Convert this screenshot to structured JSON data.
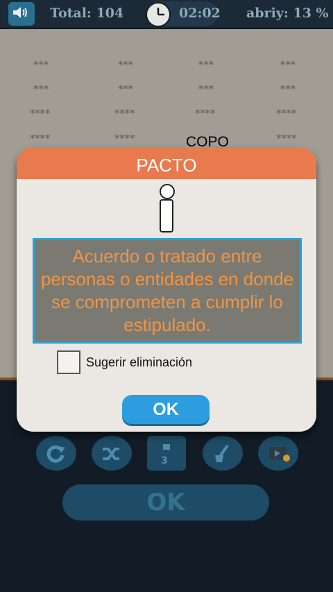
{
  "topbar": {
    "total_label": "Total: 104",
    "time": "02:02",
    "progress_label": "abriy: 13 %"
  },
  "board": {
    "rows": [
      [
        "***",
        "***",
        "***",
        "***"
      ],
      [
        "***",
        "***",
        "***",
        "***"
      ],
      [
        "****",
        "****",
        "****",
        "****"
      ],
      [
        "****",
        "****",
        "",
        "****"
      ]
    ],
    "overlay_word": "COPO"
  },
  "dialog": {
    "title": "PACTO",
    "definition": "Acuerdo o tratado entre personas o entidades en donde se comprometen a cumplir lo estipulado.",
    "checkbox_label": "Sugerir eliminación",
    "checkbox_checked": false,
    "ok_label": "OK"
  },
  "tools": {
    "hint_count": "3"
  },
  "bottom": {
    "ok_label": "OK"
  },
  "colors": {
    "dialog_header": "#e97a4e",
    "definition_text": "#f29442",
    "definition_border": "#2aa0d6",
    "ok_button": "#2c9ee0"
  }
}
